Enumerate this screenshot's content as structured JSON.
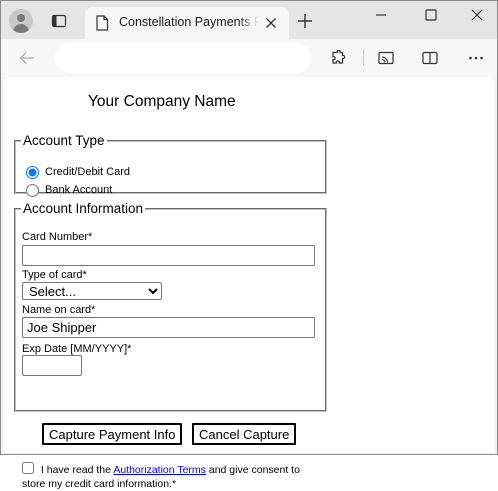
{
  "browser": {
    "tab_title": "Constellation Payments Pa",
    "address_placeholder": ""
  },
  "page": {
    "company_name": "Your Company Name",
    "account_type": {
      "legend": "Account Type",
      "options": [
        {
          "label": "Credit/Debit Card",
          "checked": true
        },
        {
          "label": "Bank Account",
          "checked": false
        }
      ]
    },
    "account_info": {
      "legend": "Account Information",
      "card_number_label": "Card Number",
      "card_number_value": "",
      "card_type_label": "Type of card",
      "card_type_selected": "Select...",
      "name_label": "Name on card",
      "name_value": "Joe Shipper",
      "exp_label": "Exp Date [MM/YYYY]",
      "exp_value": "",
      "required_mark": "*",
      "consent_prefix": "I have read the",
      "consent_link": "Authorization Terms",
      "consent_suffix": "and give consent to store my credit card information.*"
    },
    "buttons": {
      "capture": "Capture Payment Info",
      "cancel": "Cancel Capture"
    }
  },
  "icons": {
    "profile": "profile-avatar-icon",
    "tab_actions": "tab-actions-icon",
    "document": "document-icon",
    "close": "close-icon",
    "new_tab": "plus-icon",
    "minimize": "minimize-icon",
    "maximize": "maximize-icon",
    "window_close": "close-icon",
    "back": "back-arrow-icon",
    "extensions": "puzzle-icon",
    "cast": "cast-icon",
    "split": "split-screen-icon",
    "more": "more-dots-icon"
  },
  "colors": {
    "link": "#0000ee",
    "tabstrip": "#e5e5e5",
    "toolbar": "#f7f7f7"
  }
}
